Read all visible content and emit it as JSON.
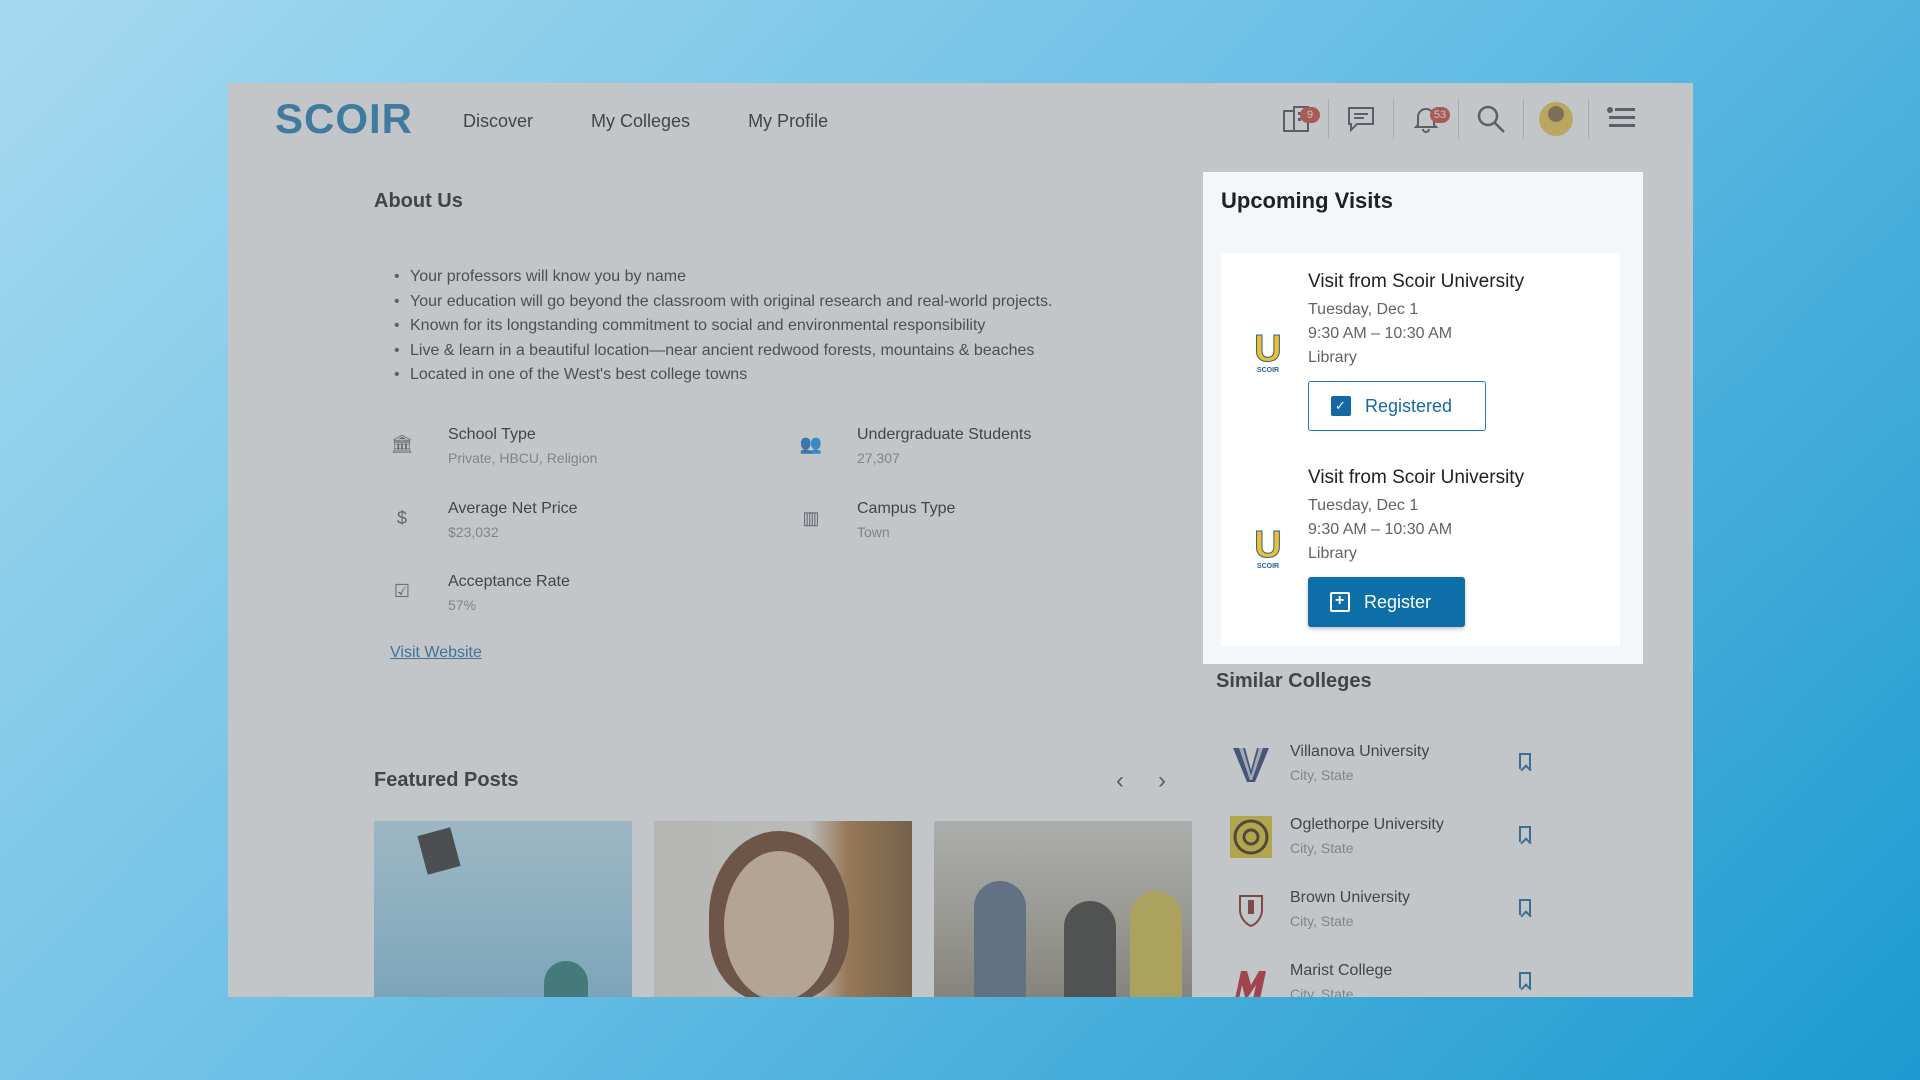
{
  "header": {
    "logo": "SCOIR",
    "nav": [
      "Discover",
      "My Colleges",
      "My Profile"
    ],
    "icons": [
      {
        "name": "colleges-icon",
        "badge": "9"
      },
      {
        "name": "messages-icon",
        "badge": ""
      },
      {
        "name": "bell-icon",
        "badge": "53"
      },
      {
        "name": "search-icon",
        "badge": ""
      },
      {
        "name": "avatar",
        "badge": ""
      },
      {
        "name": "menu-icon",
        "badge": ""
      }
    ]
  },
  "about": {
    "title": "About Us",
    "bullets": [
      "Your professors will know you by name",
      "Your education will go beyond the classroom with original research and real-world projects.",
      "Known for its longstanding commitment to social and environmental responsibility",
      "Live & learn in a beautiful location—near ancient redwood forests, mountains & beaches",
      "Located in one of the West's best college towns"
    ],
    "facts": [
      {
        "icon": "bank-icon",
        "label": "School Type",
        "value": "Private, HBCU, Religion"
      },
      {
        "icon": "people-icon",
        "label": "Undergraduate Students",
        "value": "27,307"
      },
      {
        "icon": "dollar-icon",
        "label": "Average Net Price",
        "value": "$23,032"
      },
      {
        "icon": "building-icon",
        "label": "Campus Type",
        "value": "Town"
      },
      {
        "icon": "check-tray-icon",
        "label": "Acceptance Rate",
        "value": "57%"
      }
    ],
    "link": "Visit Website"
  },
  "featured": {
    "title": "Featured Posts"
  },
  "visits": {
    "title": "Upcoming Visits",
    "items": [
      {
        "logo_text": "SCOIR",
        "title": "Visit from Scoir University",
        "date": "Tuesday, Dec 1",
        "time": "9:30 AM – 10:30 AM",
        "place": "Library",
        "button": "Registered"
      },
      {
        "logo_text": "SCOIR",
        "title": "Visit from Scoir University",
        "date": "Tuesday, Dec 1",
        "time": "9:30 AM – 10:30 AM",
        "place": "Library",
        "button": "Register"
      }
    ]
  },
  "similar": {
    "title": "Similar Colleges",
    "items": [
      {
        "name": "Villanova University",
        "location": "City, State"
      },
      {
        "name": "Oglethorpe University",
        "location": "City, State"
      },
      {
        "name": "Brown University",
        "location": "City, State"
      },
      {
        "name": "Marist College",
        "location": "City, State"
      }
    ]
  },
  "colors": {
    "accent": "#0d6ea8",
    "badge": "#d7443a",
    "logo": "#1f7fb8"
  }
}
